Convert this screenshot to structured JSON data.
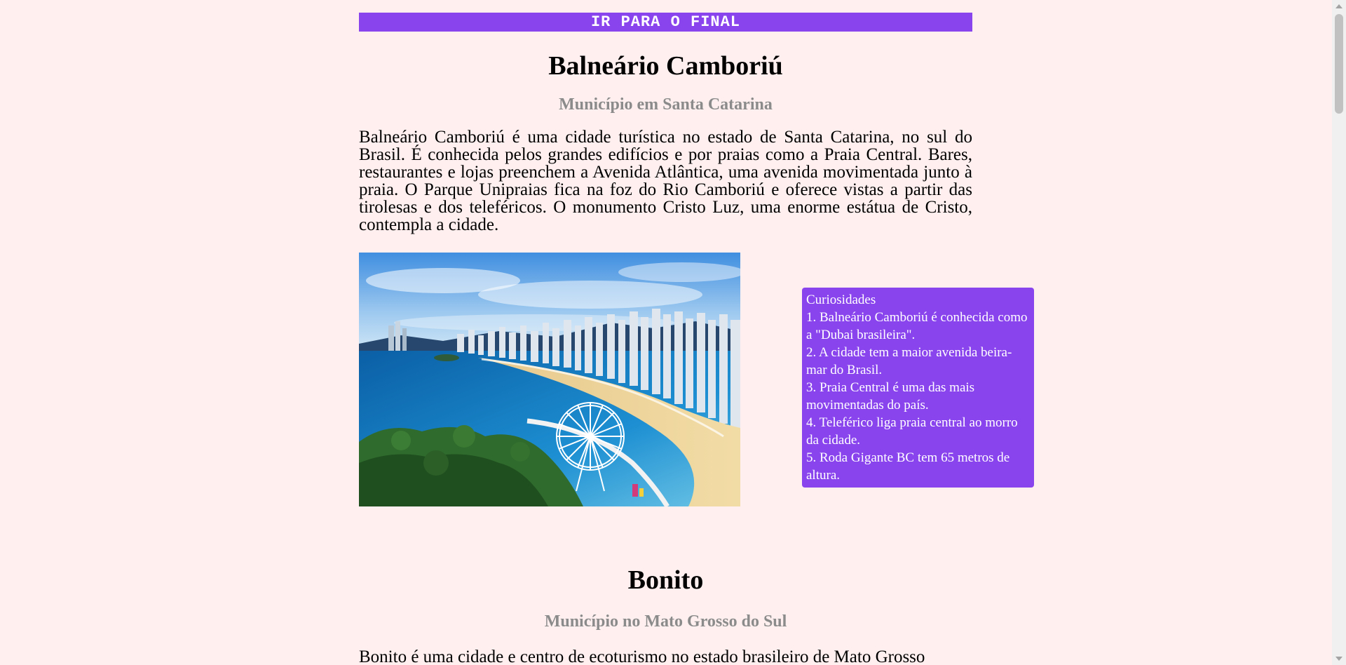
{
  "skip_link": {
    "label": "IR PARA O FINAL"
  },
  "sections": [
    {
      "title": "Balneário Camboriú",
      "subtitle": "Município em Santa Catarina",
      "description": "Balneário Camboriú é uma cidade turística no estado de Santa Catarina, no sul do Brasil. É conhecida pelos grandes edifícios e por praias como a Praia Central. Bares, restaurantes e lojas preenchem a Avenida Atlântica, uma avenida movimentada junto à praia. O Parque Unipraias fica na foz do Rio Camboriú e oferece vistas a partir das tirolesas e dos teleféricos. O monumento Cristo Luz, uma enorme estátua de Cristo, contempla a cidade.",
      "facts": {
        "heading": "Curiosidades",
        "items": [
          "1. Balneário Camboriú é conhecida como a \"Dubai brasileira\".",
          "2. A cidade tem a maior avenida beira-mar do Brasil.",
          "3. Praia Central é uma das mais movimentadas do país.",
          "4. Teleférico liga praia central ao morro da cidade.",
          "5. Roda Gigante BC tem 65 metros de altura."
        ]
      }
    },
    {
      "title": "Bonito",
      "subtitle": "Município no Mato Grosso do Sul",
      "description": "Bonito é uma cidade e centro de ecoturismo no estado brasileiro de Mato Grosso"
    }
  ],
  "colors": {
    "background": "#fff0ef",
    "accent": "#8a44ee",
    "subtitle": "#8b8b8b"
  }
}
